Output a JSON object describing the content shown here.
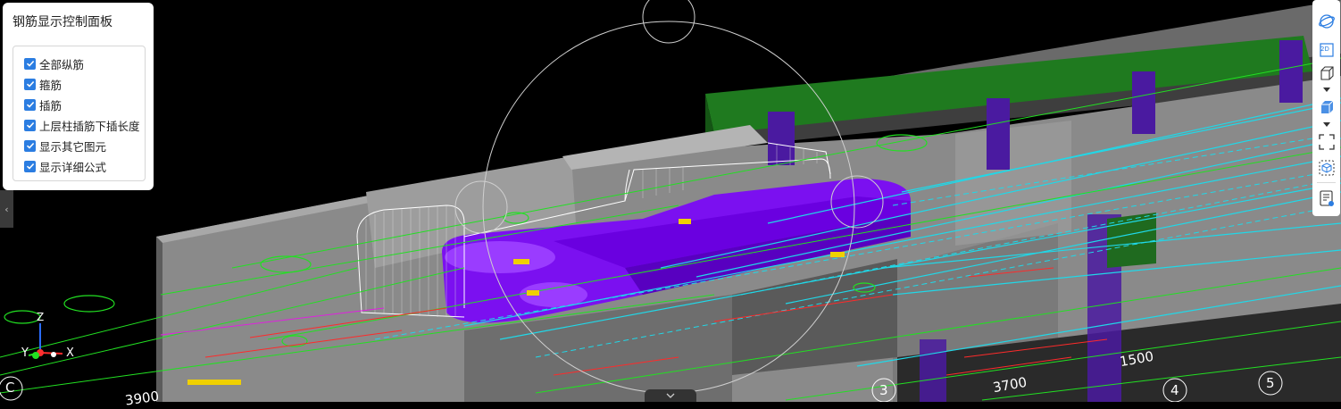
{
  "panel": {
    "title": "钢筋显示控制面板",
    "options": [
      {
        "label": "全部纵筋",
        "checked": true
      },
      {
        "label": "箍筋",
        "checked": true
      },
      {
        "label": "插筋",
        "checked": true
      },
      {
        "label": "上层柱插筋下插长度",
        "checked": true
      },
      {
        "label": "显示其它图元",
        "checked": true
      },
      {
        "label": "显示详细公式",
        "checked": true
      }
    ]
  },
  "toolbar": {
    "items": [
      "orbit-icon",
      "view-2d-icon",
      "view-3d-icon",
      "solid-box-icon",
      "fit-screen-icon",
      "section-box-icon",
      "properties-icon"
    ],
    "view_2d_label": "2D"
  },
  "axis": {
    "x": "X",
    "y": "Y",
    "z": "Z"
  },
  "grid_labels": {
    "c": "C",
    "three": "3",
    "four": "4",
    "five": "5"
  },
  "dimensions": {
    "d1": "3700",
    "d2": "1500",
    "d3": "3900"
  },
  "colors": {
    "accent": "#2b7de1",
    "rebar_purple": "#7b10f0",
    "green_beam": "#1f7a1f",
    "cyan_line": "#20d8e8",
    "slab_grey": "#8a8a8a"
  }
}
